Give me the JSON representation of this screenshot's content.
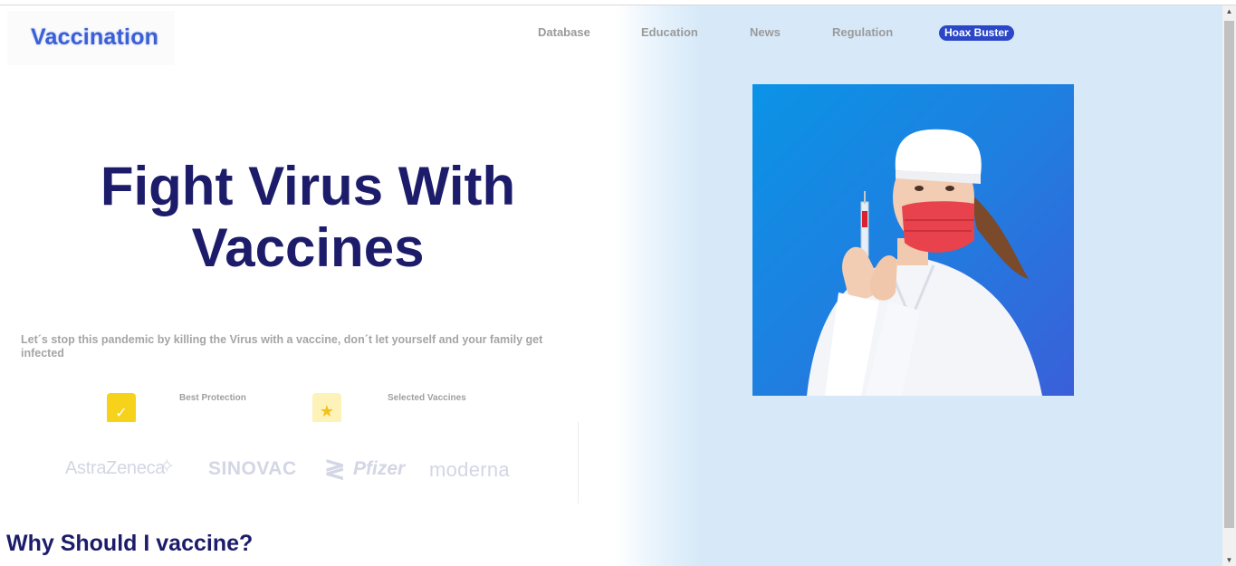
{
  "header": {
    "logo_text": "Vaccination",
    "nav": [
      {
        "label": "Database"
      },
      {
        "label": "Education"
      },
      {
        "label": "News"
      },
      {
        "label": "Regulation"
      }
    ],
    "cta": {
      "label": "Hoax Buster"
    }
  },
  "hero": {
    "title_line1": "Fight Virus With",
    "title_line2": "Vaccines",
    "subtitle": "Let´s stop this pandemic by killing the Virus with a vaccine, don´t let yourself and your family get infected",
    "features": [
      {
        "label": "Best Protection",
        "icon": "shield-check-icon"
      },
      {
        "label": "Selected Vaccines",
        "icon": "star-icon"
      }
    ]
  },
  "brands": {
    "astrazeneca": "AstraZeneca",
    "sinovac": "SINOVAC",
    "pfizer": "Pfizer",
    "moderna": "moderna"
  },
  "section": {
    "why_title": "Why Should I vaccine?"
  },
  "colors": {
    "title": "#1c1c6b",
    "accent": "#2b47c7",
    "hero_bg": "#d7e9f8",
    "photo_bg": "#1f7fe0"
  }
}
